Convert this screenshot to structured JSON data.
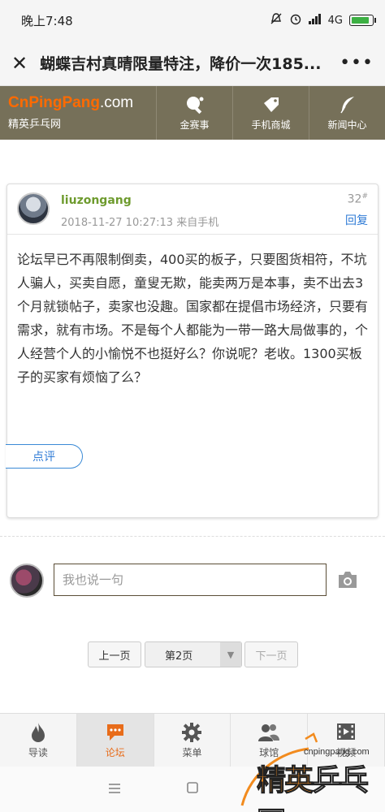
{
  "statusbar": {
    "time": "晚上7:48",
    "network": "4G",
    "battery_level": 0.9
  },
  "titlebar": {
    "close_icon": "close-icon",
    "title": "蝴蝶吉村真晴限量特注，降价一次185...",
    "more_icon": "more-dots-icon"
  },
  "header": {
    "logo_orange": "CnPingPang",
    "logo_white": ".com",
    "logo_sub": "精英乒乓网",
    "nav": [
      {
        "label": "金赛事",
        "icon": "ping-pong-paddle-icon"
      },
      {
        "label": "手机商城",
        "icon": "tag-icon"
      },
      {
        "label": "新闻中心",
        "icon": "feather-icon"
      }
    ]
  },
  "post": {
    "username": "liuzongang",
    "meta": "2018-11-27 10:27:13 来自手机",
    "floor": "32",
    "floor_mark": "#",
    "reply_label": "回复",
    "content": "论坛早已不再限制倒卖，400买的板子，只要图货相符，不坑人骗人，买卖自愿，童叟无欺，能卖两万是本事，卖不出去3个月就锁帖子，卖家也没趣。国家都在提倡市场经济，只要有需求，就有市场。不是每个人都能为一带一路大局做事的，个人经营个人的小愉悦不也挺好么？你说呢？老收。1300买板子的买家有烦恼了么？",
    "comment_label": "点评"
  },
  "reply_box": {
    "placeholder": "我也说一句",
    "camera_icon": "camera-icon"
  },
  "pagination": {
    "prev": "上一页",
    "current": "第2页",
    "next": "下一页"
  },
  "tabs": [
    {
      "label": "导读",
      "icon": "flame-icon",
      "active": false
    },
    {
      "label": "论坛",
      "icon": "chat-bubble-icon",
      "active": true
    },
    {
      "label": "菜单",
      "icon": "gear-icon",
      "active": false
    },
    {
      "label": "球馆",
      "icon": "people-icon",
      "active": false
    },
    {
      "label": "视频",
      "icon": "film-icon",
      "active": false
    }
  ],
  "watermark": {
    "url": "cnpingpang.com",
    "text_a": "精英",
    "text_b": "乒乓网"
  },
  "colors": {
    "header_bg": "#767059",
    "logo_orange": "#ff6a00",
    "username": "#6e9b2e",
    "link_blue": "#2f7bd6",
    "active_tab": "#e86c1a"
  }
}
